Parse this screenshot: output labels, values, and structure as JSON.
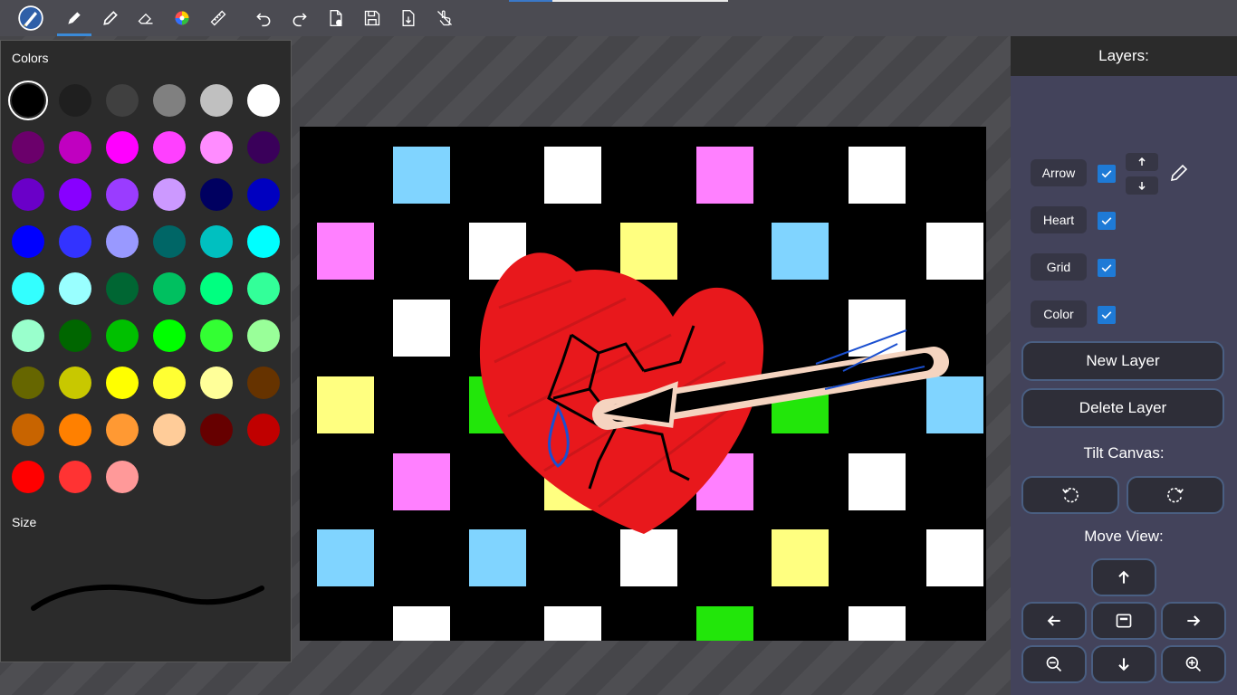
{
  "toolbar": {
    "icons": [
      "app-logo-icon",
      "ballpoint-pen-icon",
      "pencil-icon",
      "eraser-icon",
      "color-wheel-icon",
      "ruler-icon",
      "undo-icon",
      "redo-icon",
      "new-file-icon",
      "save-icon",
      "export-icon",
      "touch-drawing-icon"
    ],
    "active_tool": "ballpoint-pen"
  },
  "color_panel": {
    "colors_heading": "Colors",
    "size_heading": "Size",
    "selected_color": "#000000",
    "palette": [
      "#000000",
      "#1f1f1f",
      "#404040",
      "#808080",
      "#c0c0c0",
      "#ffffff",
      "#6b006b",
      "#c000c0",
      "#ff00ff",
      "#ff40ff",
      "#ff8cff",
      "#3a005a",
      "#6a00c8",
      "#8800ff",
      "#9a3cff",
      "#cc99ff",
      "#000060",
      "#0000c0",
      "#0000ff",
      "#3333ff",
      "#9999ff",
      "#006666",
      "#00c0c0",
      "#00ffff",
      "#33ffff",
      "#99ffff",
      "#006633",
      "#00c060",
      "#00ff80",
      "#33ff99",
      "#99ffcc",
      "#006600",
      "#00c000",
      "#00ff00",
      "#33ff33",
      "#99ff99",
      "#666600",
      "#c8c800",
      "#ffff00",
      "#ffff33",
      "#ffff99",
      "#663300",
      "#c86400",
      "#ff8000",
      "#ff9933",
      "#ffcc99",
      "#660000",
      "#c00000",
      "#ff0000",
      "#ff3333",
      "#ff9999"
    ]
  },
  "layers": {
    "header": "Layers:",
    "items": [
      {
        "name": "Arrow",
        "visible": true
      },
      {
        "name": "Heart",
        "visible": true
      },
      {
        "name": "Grid",
        "visible": true
      },
      {
        "name": "Color",
        "visible": true
      }
    ],
    "new_layer_label": "New Layer",
    "delete_layer_label": "Delete Layer"
  },
  "tilt_canvas_label": "Tilt Canvas:",
  "move_view_label": "Move View:",
  "canvas_drawing": {
    "background": "#000000",
    "square_colors": {
      "blue": "#80d4ff",
      "white": "#ffffff",
      "pink": "#ff80ff",
      "yellow": "#ffff80",
      "green": "#22e60a"
    },
    "heart_color": "#e8181c",
    "arrow_color": "#000000",
    "arrow_outline": "#f5d4c0",
    "teardrop_color": "#1a4fd0"
  }
}
